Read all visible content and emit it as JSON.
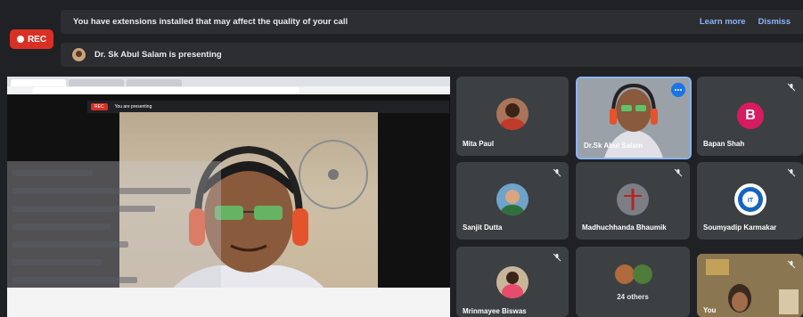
{
  "recording": {
    "label": "REC"
  },
  "banner": {
    "message": "You have extensions installed that may affect the quality of your call",
    "learn_more": "Learn more",
    "dismiss": "Dismiss"
  },
  "presenter_bar": {
    "text": "Dr. Sk Abul Salam is presenting"
  },
  "shared_screen": {
    "inner_rec": "REC",
    "inner_presenting": "You are presenting"
  },
  "participants": [
    {
      "name": "Mita Paul",
      "muted": false
    },
    {
      "name": "Dr.Sk Abul Salam",
      "muted": false,
      "active_video": true
    },
    {
      "name": "Bapan Shah",
      "muted": true,
      "initial": "B",
      "color": "#d81b60"
    },
    {
      "name": "Sanjit Dutta",
      "muted": true
    },
    {
      "name": "Madhuchhanda Bhaumik",
      "muted": true
    },
    {
      "name": "Soumyadip Karmakar",
      "muted": true
    },
    {
      "name": "Mrinmayee Biswas",
      "muted": true
    },
    {
      "name": "24 others"
    },
    {
      "name": "You",
      "muted": true
    }
  ],
  "colors": {
    "accent": "#8ab4f8",
    "rec": "#d93025",
    "tile": "#3c4043",
    "bg": "#202124"
  }
}
